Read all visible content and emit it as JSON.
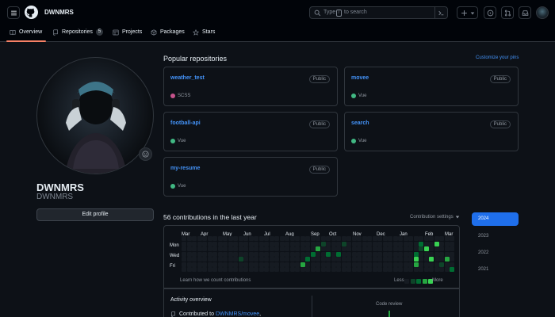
{
  "header": {
    "username": "DWNMRS",
    "search_placeholder_pre": "Type",
    "search_key": "/",
    "search_placeholder_post": "to search",
    "tabs": [
      {
        "label": "Overview",
        "icon": "book-icon"
      },
      {
        "label": "Repositories",
        "icon": "repo-icon",
        "count": "5"
      },
      {
        "label": "Projects",
        "icon": "table-icon"
      },
      {
        "label": "Packages",
        "icon": "package-icon"
      },
      {
        "label": "Stars",
        "icon": "star-icon"
      }
    ]
  },
  "profile": {
    "name": "DWNMRS",
    "login": "DWNMRS",
    "edit_label": "Edit profile"
  },
  "popular": {
    "title": "Popular repositories",
    "customize_label": "Customize your pins",
    "repos": [
      {
        "name": "weather_test",
        "visibility": "Public",
        "language": "SCSS",
        "lang_color": "#c6538c"
      },
      {
        "name": "movee",
        "visibility": "Public",
        "language": "Vue",
        "lang_color": "#41b883"
      },
      {
        "name": "football-api",
        "visibility": "Public",
        "language": "Vue",
        "lang_color": "#41b883"
      },
      {
        "name": "search",
        "visibility": "Public",
        "language": "Vue",
        "lang_color": "#41b883"
      },
      {
        "name": "my-resume",
        "visibility": "Public",
        "language": "Vue",
        "lang_color": "#41b883"
      }
    ]
  },
  "contributions": {
    "title": "56 contributions in the last year",
    "settings_label": "Contribution settings",
    "months": [
      "Mar",
      "Apr",
      "May",
      "Jun",
      "Jul",
      "Aug",
      "Sep",
      "Oct",
      "Nov",
      "Dec",
      "Jan",
      "Feb",
      "Mar"
    ],
    "days": [
      "Mon",
      "Wed",
      "Fri"
    ],
    "learn_label": "Learn how we count contributions",
    "less_label": "Less",
    "more_label": "More",
    "colors": [
      "#161b22",
      "#0e4429",
      "#006d32",
      "#26a641",
      "#39d353"
    ]
  },
  "years": [
    "2024",
    "2023",
    "2022",
    "2021"
  ],
  "activity": {
    "title": "Activity overview",
    "contributed_prefix": "Contributed to",
    "contributed_repo": "DWNMRS/movee",
    "chart_label": "Code review"
  }
}
